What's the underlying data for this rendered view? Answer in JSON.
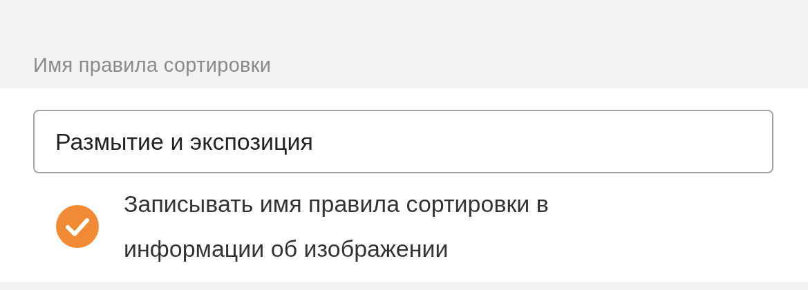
{
  "section": {
    "label": "Имя правила сортировки"
  },
  "name_field": {
    "value": "Размытие и экспозиция"
  },
  "option": {
    "label": "Записывать имя правила сортировки в информации об изображении",
    "checked": true
  }
}
